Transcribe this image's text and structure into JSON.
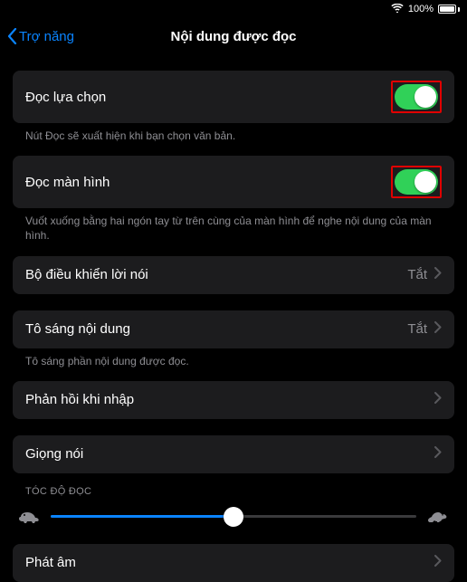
{
  "status": {
    "battery_pct": "100%"
  },
  "nav": {
    "back": "Trợ năng",
    "title": "Nội dung được đọc"
  },
  "rows": {
    "speak_selection": {
      "label": "Đọc lựa chọn",
      "on": true,
      "footer": "Nút Đọc sẽ xuất hiện khi bạn chọn văn bản."
    },
    "speak_screen": {
      "label": "Đọc màn hình",
      "on": true,
      "footer": "Vuốt xuống bằng hai ngón tay từ trên cùng của màn hình để nghe nội dung của màn hình."
    },
    "speech_controller": {
      "label": "Bộ điều khiển lời nói",
      "value": "Tắt"
    },
    "highlight_content": {
      "label": "Tô sáng nội dung",
      "value": "Tắt",
      "footer": "Tô sáng phần nội dung được đọc."
    },
    "typing_feedback": {
      "label": "Phản hồi khi nhập"
    },
    "voices": {
      "label": "Giọng nói"
    },
    "pronunciations": {
      "label": "Phát âm"
    }
  },
  "speed": {
    "header": "TÓC ĐỘ ĐỌC",
    "value_pct": 50
  }
}
